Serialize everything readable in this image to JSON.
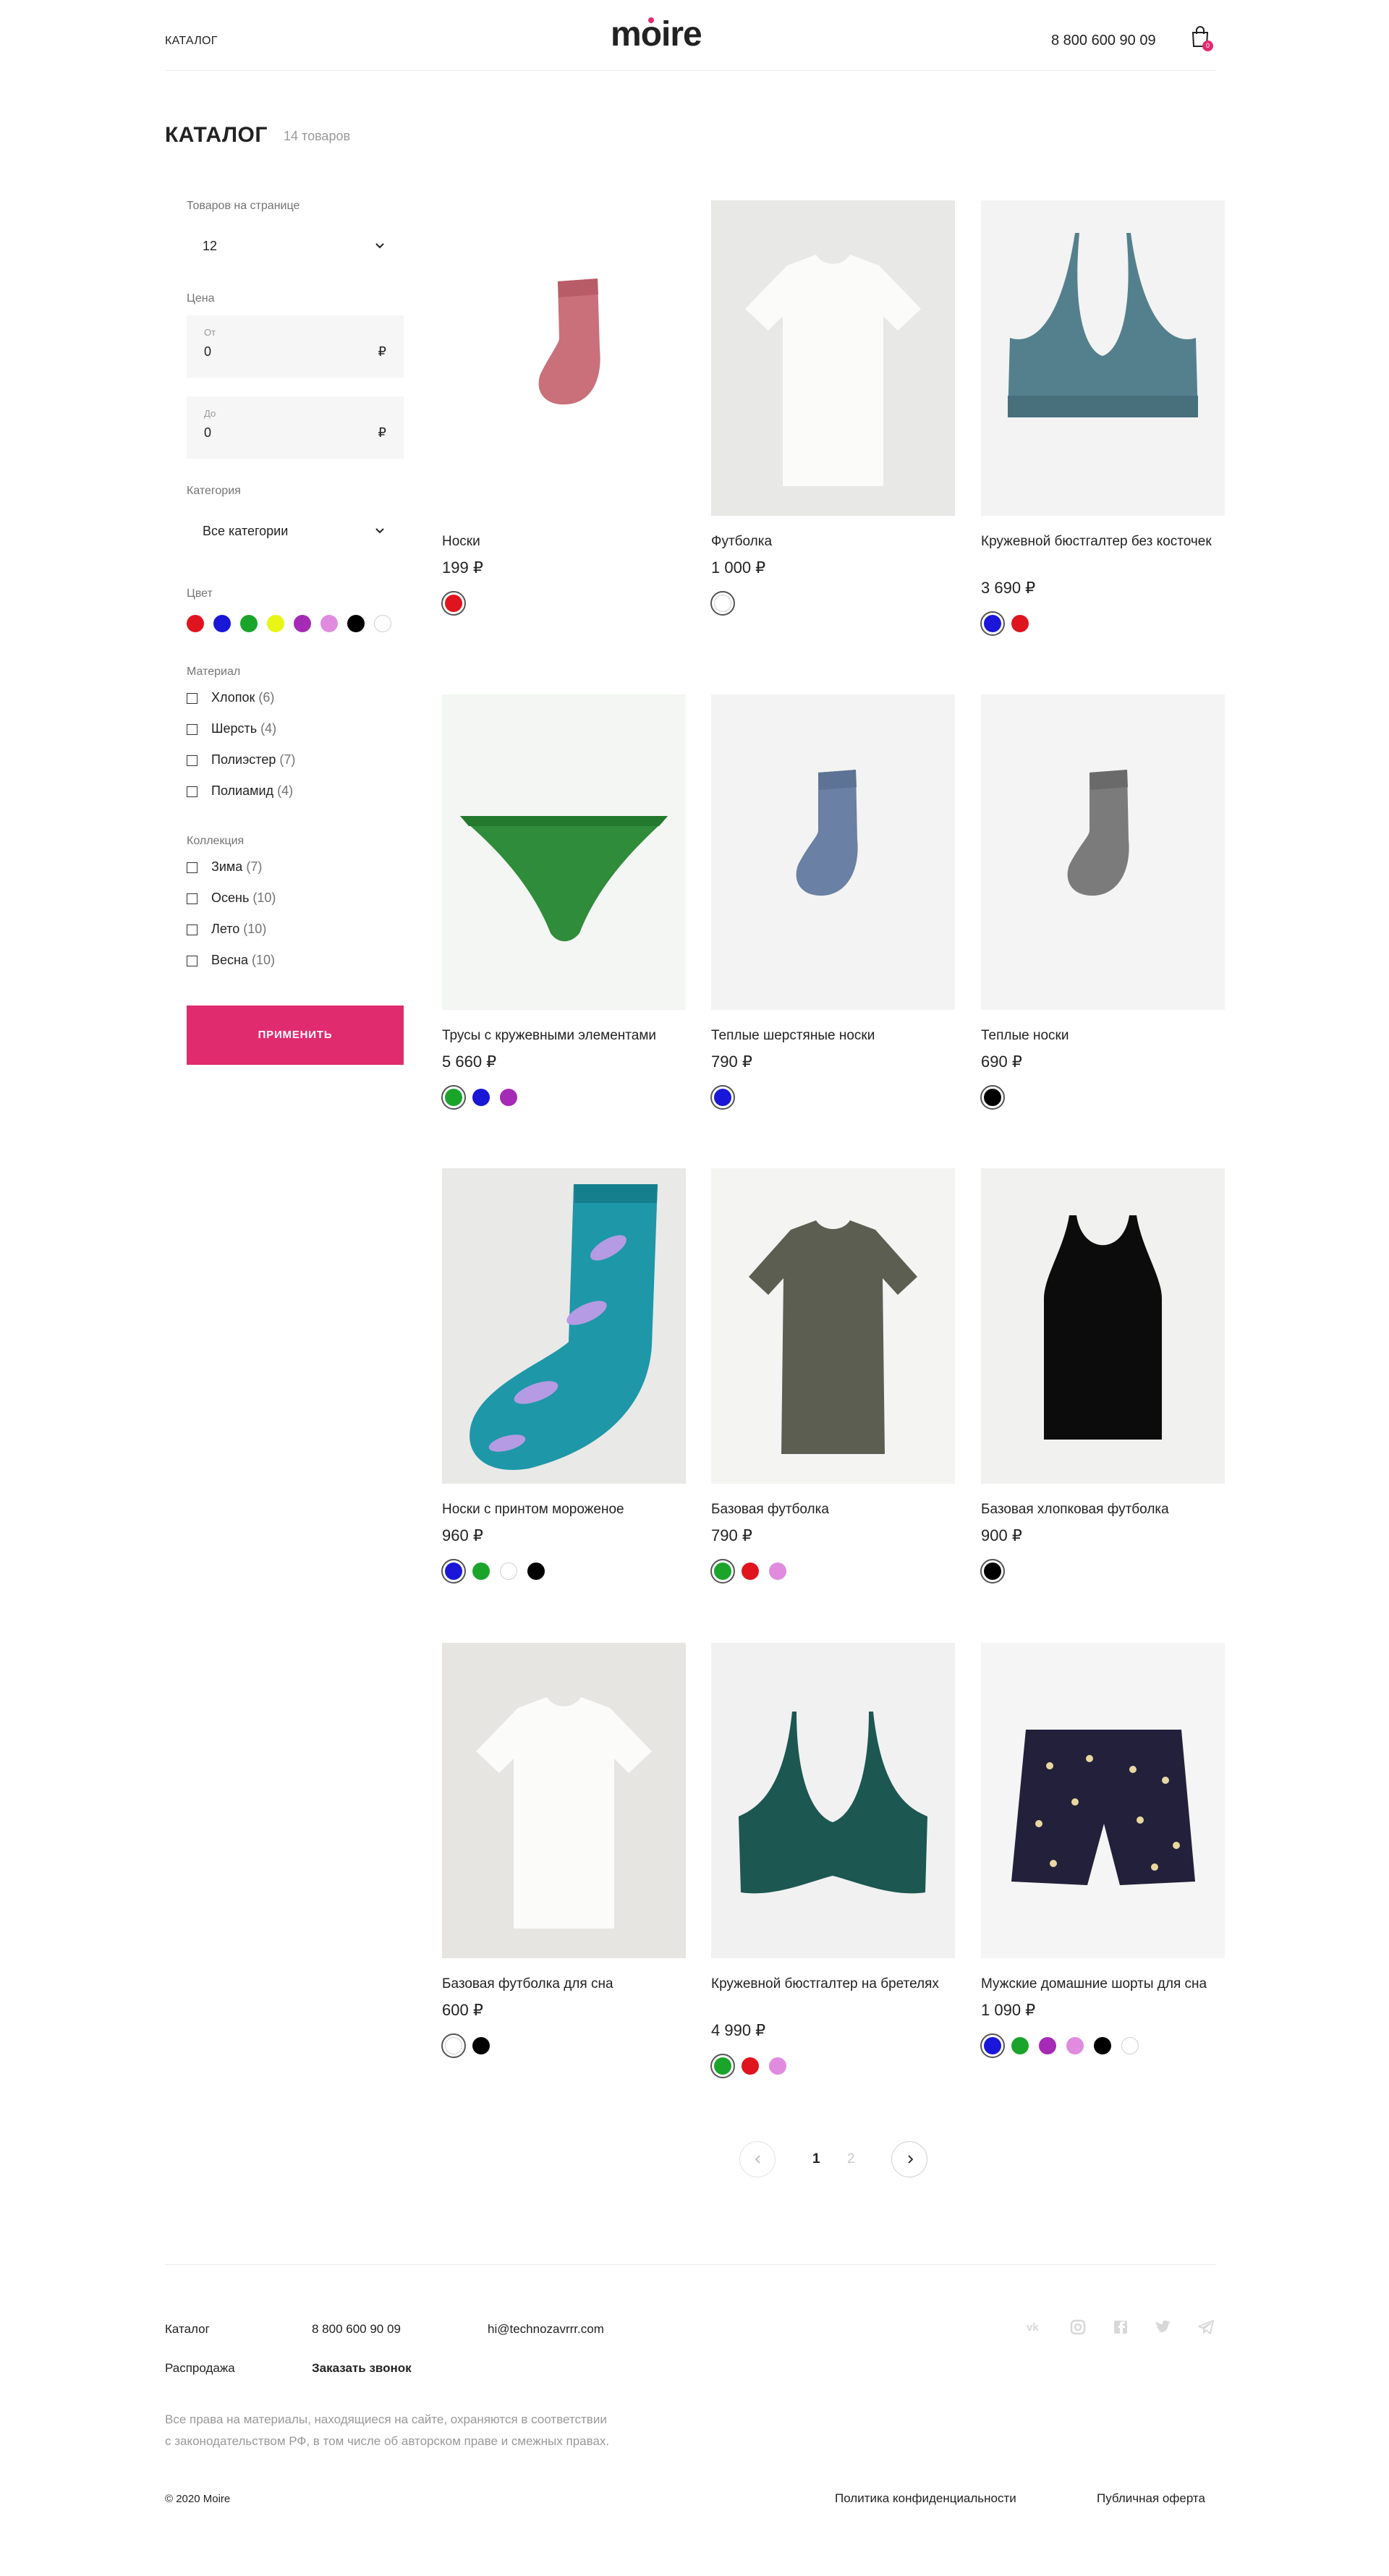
{
  "header": {
    "nav_catalog": "КАТАЛОГ",
    "logo": "moire",
    "phone": "8 800 600 90 09",
    "cart_count": "0",
    "cart_icon": "bag-icon"
  },
  "page": {
    "title": "КАТАЛОГ",
    "count": "14 товаров"
  },
  "filters": {
    "per_page_label": "Товаров на странице",
    "per_page_value": "12",
    "price_label": "Цена",
    "price_from_label": "От",
    "price_from_value": "0",
    "price_to_label": "До",
    "price_to_value": "0",
    "currency": "₽",
    "category_label": "Категория",
    "category_value": "Все категории",
    "color_label": "Цвет",
    "colors": [
      "#e0141e",
      "#1a17d8",
      "#1aa52a",
      "#e8f516",
      "#a52ab5",
      "#e08be0",
      "#000000",
      "#ffffff"
    ],
    "material_label": "Материал",
    "materials": [
      {
        "name": "Хлопок",
        "count": "(6)"
      },
      {
        "name": "Шерсть",
        "count": "(4)"
      },
      {
        "name": "Полиэстер",
        "count": "(7)"
      },
      {
        "name": "Полиамид",
        "count": "(4)"
      }
    ],
    "collection_label": "Коллекция",
    "collections": [
      {
        "name": "Зима",
        "count": "(7)"
      },
      {
        "name": "Осень",
        "count": "(10)"
      },
      {
        "name": "Лето",
        "count": "(10)"
      },
      {
        "name": "Весна",
        "count": "(10)"
      }
    ],
    "apply_label": "ПРИМЕНИТЬ"
  },
  "products": [
    {
      "name": "Носки",
      "price": "199 ₽",
      "colors": [
        "#e0141e"
      ],
      "image": "pink-sock"
    },
    {
      "name": "Футболка",
      "price": "1 000 ₽",
      "colors": [
        "#ffffff"
      ],
      "image": "white-tshirt"
    },
    {
      "name": "Кружевной бюстгалтер без косточек",
      "price": "3 690 ₽",
      "colors": [
        "#1a17d8",
        "#e0141e"
      ],
      "image": "blue-lace-bra"
    },
    {
      "name": "Трусы с кружевными элементами",
      "price": "5 660 ₽",
      "colors": [
        "#1aa52a",
        "#1a17d8",
        "#a52ab5"
      ],
      "image": "green-briefs"
    },
    {
      "name": "Теплые шерстяные носки",
      "price": "790 ₽",
      "colors": [
        "#1a17d8"
      ],
      "image": "blue-sock"
    },
    {
      "name": "Теплые носки",
      "price": "690 ₽",
      "colors": [
        "#000000"
      ],
      "image": "grey-sock"
    },
    {
      "name": "Носки с принтом мороженое",
      "price": "960 ₽",
      "colors": [
        "#1a17d8",
        "#1aa52a",
        "#ffffff",
        "#000000"
      ],
      "image": "teal-print-sock"
    },
    {
      "name": "Базовая футболка",
      "price": "790 ₽",
      "colors": [
        "#1aa52a",
        "#e0141e",
        "#e08be0"
      ],
      "image": "olive-tshirt"
    },
    {
      "name": "Базовая хлопковая футболка",
      "price": "900 ₽",
      "colors": [
        "#000000"
      ],
      "image": "black-tank"
    },
    {
      "name": "Базовая футболка для сна",
      "price": "600 ₽",
      "colors": [
        "#ffffff",
        "#000000"
      ],
      "image": "white-tshirt-2"
    },
    {
      "name": "Кружевной бюстгалтер на бретелях",
      "price": "4 990 ₽",
      "colors": [
        "#1aa52a",
        "#e0141e",
        "#e08be0"
      ],
      "image": "green-bra"
    },
    {
      "name": "Мужские домашние шорты для сна",
      "price": "1 090 ₽",
      "colors": [
        "#1a17d8",
        "#1aa52a",
        "#a52ab5",
        "#e08be0",
        "#000000",
        "#ffffff"
      ],
      "image": "navy-shorts"
    }
  ],
  "pagination": {
    "current": "1",
    "other": "2"
  },
  "footer": {
    "catalog": "Каталог",
    "sale": "Распродажа",
    "phone": "8 800 600 90 09",
    "callback": "Заказать звонок",
    "email": "hi@technozavrrr.com",
    "rights_line1": "Все права на материалы, находящиеся на сайте, охраняются в соответствии",
    "rights_line2": "с законодательством РФ, в том числе об авторском праве и смежных правах.",
    "copyright": "© 2020 Moire",
    "privacy": "Политика конфиденциальности",
    "offer": "Публичная оферта",
    "social": [
      "vk-icon",
      "instagram-icon",
      "facebook-icon",
      "twitter-icon",
      "telegram-icon"
    ]
  },
  "accent_color": "#e02b6f"
}
